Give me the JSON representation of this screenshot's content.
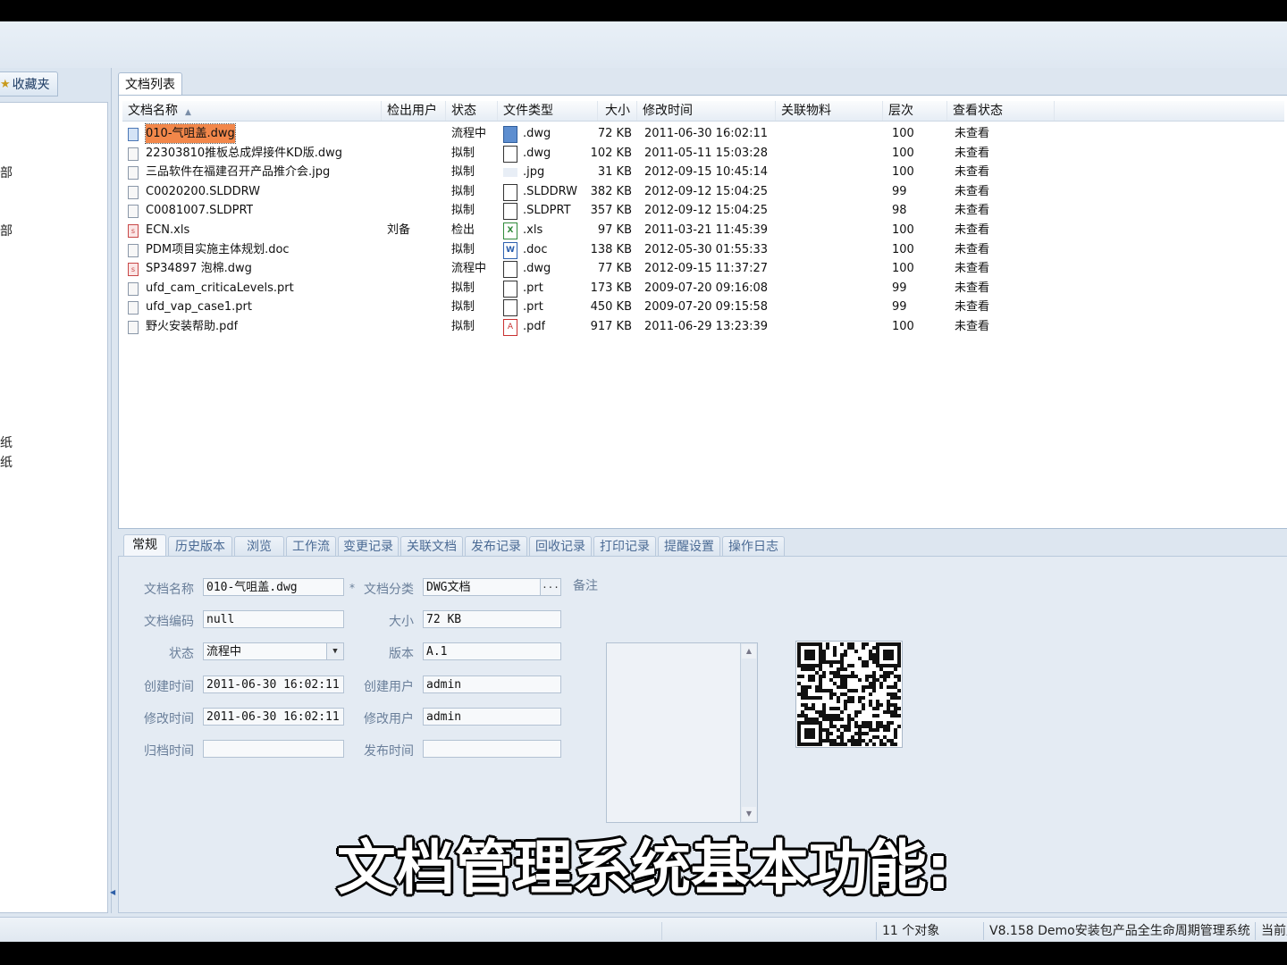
{
  "left_panel": {
    "fav_tab_label": "收藏夹",
    "tree_items": [
      "部",
      "部",
      "纸",
      "纸"
    ]
  },
  "doc_list": {
    "tab_label": "文档列表",
    "columns": [
      "文档名称",
      "检出用户",
      "状态",
      "文件类型",
      "大小",
      "修改时间",
      "关联物料",
      "层次",
      "查看状态"
    ],
    "rows": [
      {
        "name": "010-气咀盖.dwg",
        "checkout": "",
        "status": "流程中",
        "type": ".dwg",
        "size": "72 KB",
        "modified": "2011-06-30 16:02:11",
        "material": "",
        "level": "100",
        "view": "未查看"
      },
      {
        "name": "22303810推板总成焊接件KD版.dwg",
        "checkout": "",
        "status": "拟制",
        "type": ".dwg",
        "size": "102 KB",
        "modified": "2011-05-11 15:03:28",
        "material": "",
        "level": "100",
        "view": "未查看"
      },
      {
        "name": "三品软件在福建召开产品推介会.jpg",
        "checkout": "",
        "status": "拟制",
        "type": ".jpg",
        "size": "31 KB",
        "modified": "2012-09-15 10:45:14",
        "material": "",
        "level": "100",
        "view": "未查看"
      },
      {
        "name": "C0020200.SLDDRW",
        "checkout": "",
        "status": "拟制",
        "type": ".SLDDRW",
        "size": "382 KB",
        "modified": "2012-09-12 15:04:25",
        "material": "",
        "level": "99",
        "view": "未查看"
      },
      {
        "name": "C0081007.SLDPRT",
        "checkout": "",
        "status": "拟制",
        "type": ".SLDPRT",
        "size": "357 KB",
        "modified": "2012-09-12 15:04:25",
        "material": "",
        "level": "98",
        "view": "未查看"
      },
      {
        "name": "ECN.xls",
        "checkout": "刘备",
        "status": "检出",
        "type": ".xls",
        "size": "97 KB",
        "modified": "2011-03-21 11:45:39",
        "material": "",
        "level": "100",
        "view": "未查看"
      },
      {
        "name": "PDM项目实施主体规划.doc",
        "checkout": "",
        "status": "拟制",
        "type": ".doc",
        "size": "138 KB",
        "modified": "2012-05-30 01:55:33",
        "material": "",
        "level": "100",
        "view": "未查看"
      },
      {
        "name": "SP34897 泡棉.dwg",
        "checkout": "",
        "status": "流程中",
        "type": ".dwg",
        "size": "77 KB",
        "modified": "2012-09-15 11:37:27",
        "material": "",
        "level": "100",
        "view": "未查看"
      },
      {
        "name": "ufd_cam_criticaLevels.prt",
        "checkout": "",
        "status": "拟制",
        "type": ".prt",
        "size": "173 KB",
        "modified": "2009-07-20 09:16:08",
        "material": "",
        "level": "99",
        "view": "未查看"
      },
      {
        "name": "ufd_vap_case1.prt",
        "checkout": "",
        "status": "拟制",
        "type": ".prt",
        "size": "450 KB",
        "modified": "2009-07-20 09:15:58",
        "material": "",
        "level": "99",
        "view": "未查看"
      },
      {
        "name": "野火安装帮助.pdf",
        "checkout": "",
        "status": "拟制",
        "type": ".pdf",
        "size": "917 KB",
        "modified": "2011-06-29 13:23:39",
        "material": "",
        "level": "100",
        "view": "未查看"
      }
    ]
  },
  "detail": {
    "tabs": [
      "常规",
      "历史版本",
      "浏览",
      "工作流",
      "变更记录",
      "关联文档",
      "发布记录",
      "回收记录",
      "打印记录",
      "提醒设置",
      "操作日志"
    ],
    "labels": {
      "doc_name": "文档名称",
      "doc_code": "文档编码",
      "status": "状态",
      "created_time": "创建时间",
      "modified_time": "修改时间",
      "archive_time": "归档时间",
      "doc_category": "文档分类",
      "size": "大小",
      "version": "版本",
      "created_user": "创建用户",
      "modified_user": "修改用户",
      "publish_time": "发布时间",
      "memo": "备注"
    },
    "values": {
      "doc_name": "010-气咀盖.dwg",
      "doc_code": "null",
      "status": "流程中",
      "created_time": "2011-06-30 16:02:11",
      "modified_time": "2011-06-30 16:02:11",
      "archive_time": "",
      "doc_category": "DWG文档",
      "size": "72 KB",
      "version": "A.1",
      "created_user": "admin",
      "modified_user": "admin",
      "publish_time": ""
    },
    "required_mark": "*",
    "category_button": "..."
  },
  "statusbar": {
    "count": "11 个对象",
    "version_text": "V8.158 Demo安装包产品全生命周期管理系统",
    "extra": "当前用"
  },
  "subtitle": "文档管理系统基本功能:",
  "colors": {
    "selection": "#f2874a",
    "panel_bg": "#dde6f0",
    "label": "#6a7f9a"
  }
}
